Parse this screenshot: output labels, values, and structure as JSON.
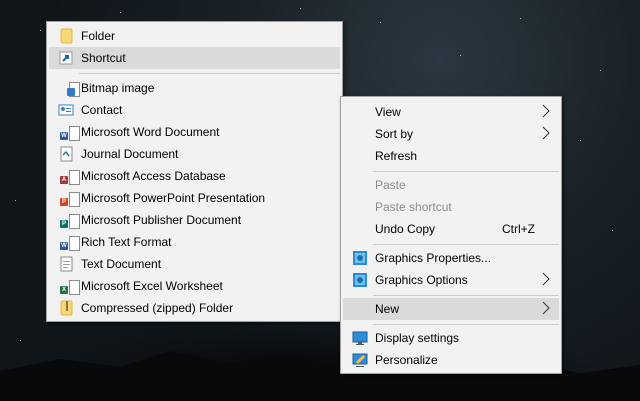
{
  "new_submenu": {
    "items": [
      {
        "label": "Folder",
        "icon": "folder-icon"
      },
      {
        "label": "Shortcut",
        "icon": "shortcut-icon"
      },
      {
        "label": "Bitmap image",
        "icon": "bitmap-image-icon"
      },
      {
        "label": "Contact",
        "icon": "contact-icon"
      },
      {
        "label": "Microsoft Word Document",
        "icon": "word-document-icon"
      },
      {
        "label": "Journal Document",
        "icon": "journal-document-icon"
      },
      {
        "label": "Microsoft Access Database",
        "icon": "access-database-icon"
      },
      {
        "label": "Microsoft PowerPoint Presentation",
        "icon": "powerpoint-icon"
      },
      {
        "label": "Microsoft Publisher Document",
        "icon": "publisher-icon"
      },
      {
        "label": "Rich Text Format",
        "icon": "rich-text-icon"
      },
      {
        "label": "Text Document",
        "icon": "text-document-icon"
      },
      {
        "label": "Microsoft Excel Worksheet",
        "icon": "excel-icon"
      },
      {
        "label": "Compressed (zipped) Folder",
        "icon": "zip-folder-icon"
      }
    ]
  },
  "context_menu": {
    "items": [
      {
        "label": "View",
        "submenu": true
      },
      {
        "label": "Sort by",
        "submenu": true
      },
      {
        "label": "Refresh"
      },
      {
        "label": "Paste",
        "disabled": true
      },
      {
        "label": "Paste shortcut",
        "disabled": true
      },
      {
        "label": "Undo Copy",
        "shortcut": "Ctrl+Z"
      },
      {
        "label": "Graphics Properties...",
        "icon": "graphics-icon"
      },
      {
        "label": "Graphics Options",
        "icon": "graphics-icon",
        "submenu": true
      },
      {
        "label": "New",
        "submenu": true,
        "highlighted": true
      },
      {
        "label": "Display settings",
        "icon": "display-icon"
      },
      {
        "label": "Personalize",
        "icon": "personalize-icon"
      }
    ]
  },
  "colors": {
    "menu_bg": "#f2f2f2",
    "highlight": "#dadada",
    "disabled_text": "#8c8c8c",
    "word_blue": "#2b579a",
    "access_red": "#a4373a",
    "powerpoint_orange": "#d24726",
    "publisher_teal": "#077568",
    "excel_green": "#217346"
  }
}
